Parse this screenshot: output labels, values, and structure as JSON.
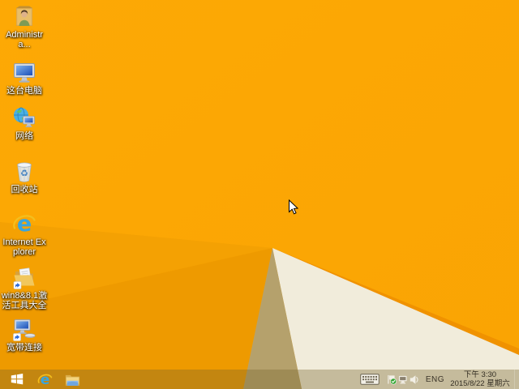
{
  "desktop": {
    "icons": [
      {
        "name": "administrator-folder",
        "label": "Administra..."
      },
      {
        "name": "this-pc",
        "label": "这台电脑"
      },
      {
        "name": "network",
        "label": "网络"
      },
      {
        "name": "recycle-bin",
        "label": "回收站"
      },
      {
        "name": "internet-explorer",
        "label": "Internet Explorer"
      },
      {
        "name": "win8-activation-tools",
        "label": "win8&8.1激活工具大全"
      },
      {
        "name": "broadband-connection",
        "label": "宽带连接"
      }
    ]
  },
  "taskbar": {
    "buttons": [
      {
        "name": "start-button",
        "icon": "windows-logo-icon"
      },
      {
        "name": "ie-taskbar-button",
        "icon": "internet-explorer-icon"
      },
      {
        "name": "explorer-taskbar-button",
        "icon": "file-explorer-icon"
      }
    ],
    "tray": {
      "icons": [
        "touch-keyboard-icon",
        "action-center-check-icon",
        "network-status-icon",
        "volume-icon"
      ],
      "language": "ENG",
      "time": "下午 3:30",
      "date": "2015/8/22 星期六"
    }
  },
  "colors": {
    "wallpaper_base": "#FCA704",
    "wallpaper_shade1": "#F4A103",
    "wallpaper_shade2": "#EE9A00",
    "wallpaper_khaki": "#B5A16C",
    "wallpaper_cream": "#F1ECDB",
    "wallpaper_ridge": "#F09200",
    "taskbar_tint": "#76632C",
    "icon_label_text": "#FFFFFF",
    "tray_text": "#3A3328"
  }
}
